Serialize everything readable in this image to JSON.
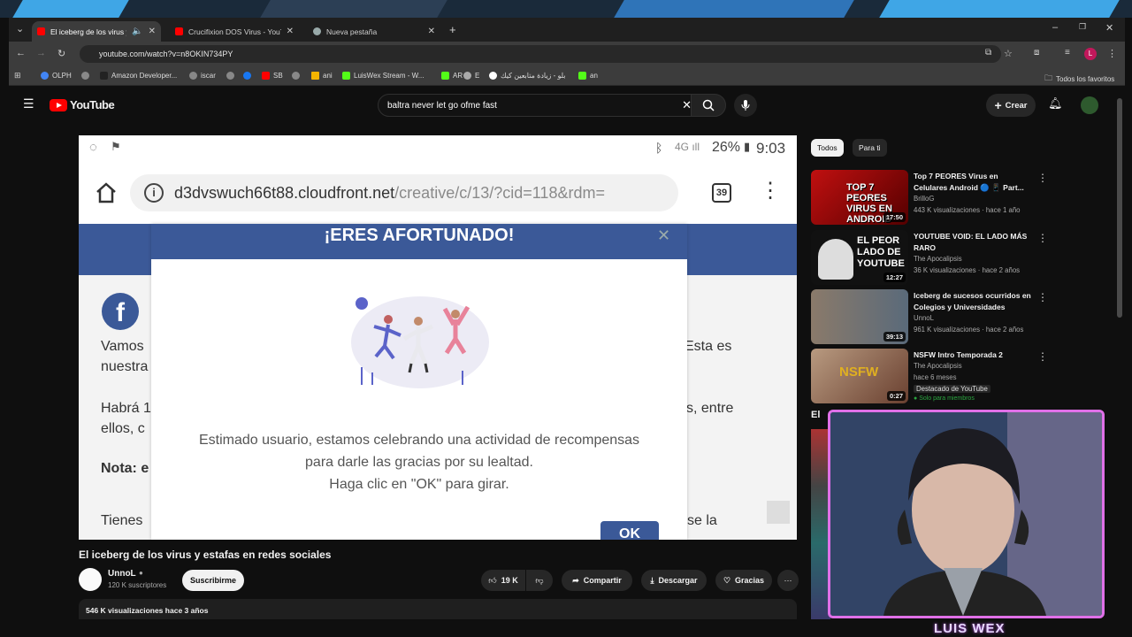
{
  "browser": {
    "tabs": [
      {
        "title": "El iceberg de los virus y esta",
        "active": true
      },
      {
        "title": "Crucifixion DOS Virus - YouTub",
        "active": false
      },
      {
        "title": "Nueva pestaña",
        "active": false
      }
    ],
    "url": "youtube.com/watch?v=n8OKIN734PY",
    "bookmarks": [
      "OLPH",
      "Amazon Developer...",
      "iscar",
      "SB",
      "ani",
      "LuisWex Stream - W...",
      "AR",
      "E",
      "بلو - زيادة متابعين كيك",
      "an"
    ],
    "all_bookmarks": "Todos los favoritos"
  },
  "youtube": {
    "logo": "YouTube",
    "search_query": "baltra never let go ofme fast",
    "create_label": "Crear",
    "video": {
      "status_bar": {
        "battery": "26%",
        "time": "9:03"
      },
      "phone_url_host": "d3dvswuch66t88.cloudfront.net",
      "phone_url_path": "/creative/c/13/?cid=118&rdm=",
      "tab_count": "39",
      "modal_title": "¡ERES AFORTUNADO!",
      "modal_line1": "Estimado usuario, estamos celebrando una actividad de recompensas",
      "modal_line2": "para darle las gracias por su lealtad.",
      "modal_line3": "Haga clic en \"OK\" para girar.",
      "ok_label": "OK",
      "bg_texts": [
        "Vamos",
        "nuestra",
        "Habrá 1",
        "ellos, c",
        "Nota: e",
        "Tienes",
        "Esta es",
        "s, entre",
        "se la"
      ]
    },
    "title": "El iceberg de los virus y estafas en redes sociales",
    "channel": {
      "name": "UnnoL",
      "subs": "120 K suscriptores",
      "subscribe_label": "Suscribirme"
    },
    "actions": {
      "likes": "19 K",
      "share": "Compartir",
      "download": "Descargar",
      "thanks": "Gracias"
    },
    "description": {
      "views": "546 K visualizaciones",
      "age": "hace 3 años"
    },
    "chips": [
      "Todos",
      "Para ti"
    ],
    "recommendations": [
      {
        "title": "Top 7 PEORES Virus en Celulares Android 🔵 📱 Part...",
        "channel": "BrilloG",
        "meta": "443 K visualizaciones · hace 1 año",
        "duration": "17:50",
        "thumb_text": "TOP 7 PEORES VIRUS EN ANDROID"
      },
      {
        "title": "YOUTUBE VOID: EL LADO MÁS RARO",
        "channel": "The Apocalipsis",
        "meta": "36 K visualizaciones · hace 2 años",
        "duration": "12:27",
        "thumb_text": "EL PEOR LADO DE YOUTUBE"
      },
      {
        "title": "Iceberg de sucesos ocurridos en Colegios y Universidades",
        "channel": "UnnoL",
        "meta": "961 K visualizaciones · hace 2 años",
        "duration": "39:13",
        "thumb_text": ""
      },
      {
        "title": "NSFW Intro Temporada 2",
        "channel": "The Apocalipsis",
        "meta": "hace 6 meses",
        "duration": "0:27",
        "thumb_text": "NSFW",
        "badge1": "Destacado de YouTube",
        "badge2": "Solo para miembros"
      }
    ],
    "partial_section_letter": "El"
  },
  "stream": {
    "overlay_name": "LUIS WEX"
  }
}
